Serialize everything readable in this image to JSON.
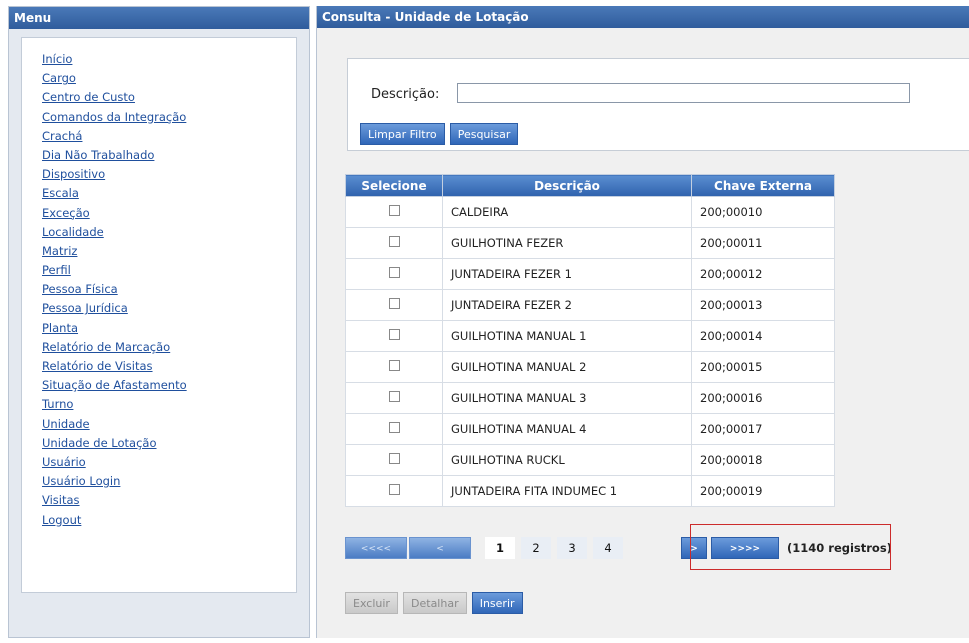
{
  "sidebar": {
    "title": "Menu",
    "items": [
      {
        "label": "Início"
      },
      {
        "label": "Cargo"
      },
      {
        "label": "Centro de Custo"
      },
      {
        "label": "Comandos da Integração"
      },
      {
        "label": "Crachá"
      },
      {
        "label": "Dia Não Trabalhado"
      },
      {
        "label": "Dispositivo"
      },
      {
        "label": "Escala"
      },
      {
        "label": "Exceção"
      },
      {
        "label": "Localidade"
      },
      {
        "label": "Matriz"
      },
      {
        "label": "Perfil"
      },
      {
        "label": "Pessoa Física"
      },
      {
        "label": "Pessoa Jurídica"
      },
      {
        "label": "Planta"
      },
      {
        "label": "Relatório de Marcação"
      },
      {
        "label": "Relatório de Visitas"
      },
      {
        "label": "Situação de Afastamento"
      },
      {
        "label": "Turno"
      },
      {
        "label": "Unidade"
      },
      {
        "label": "Unidade de Lotação"
      },
      {
        "label": "Usuário"
      },
      {
        "label": "Usuário Login"
      },
      {
        "label": "Visitas"
      },
      {
        "label": "Logout"
      }
    ]
  },
  "main": {
    "title": "Consulta - Unidade de Lotação",
    "filter": {
      "description_label": "Descrição:",
      "description_value": "",
      "clear_label": "Limpar Filtro",
      "search_label": "Pesquisar"
    },
    "table": {
      "headers": [
        "Selecione",
        "Descrição",
        "Chave Externa"
      ],
      "rows": [
        {
          "descricao": "CALDEIRA",
          "chave": "200;00010"
        },
        {
          "descricao": "GUILHOTINA FEZER",
          "chave": "200;00011"
        },
        {
          "descricao": "JUNTADEIRA FEZER 1",
          "chave": "200;00012"
        },
        {
          "descricao": "JUNTADEIRA FEZER 2",
          "chave": "200;00013"
        },
        {
          "descricao": "GUILHOTINA MANUAL 1",
          "chave": "200;00014"
        },
        {
          "descricao": "GUILHOTINA MANUAL 2",
          "chave": "200;00015"
        },
        {
          "descricao": "GUILHOTINA MANUAL 3",
          "chave": "200;00016"
        },
        {
          "descricao": "GUILHOTINA MANUAL 4",
          "chave": "200;00017"
        },
        {
          "descricao": "GUILHOTINA RUCKL",
          "chave": "200;00018"
        },
        {
          "descricao": "JUNTADEIRA FITA INDUMEC 1",
          "chave": "200;00019"
        }
      ]
    },
    "pager": {
      "first_label": "<<<<",
      "prev_label": "<",
      "pages": [
        "1",
        "2",
        "3",
        "4"
      ],
      "current_page": "1",
      "next_label": ">",
      "last_label": ">>>>",
      "count_text": "(1140 registros)"
    },
    "actions": {
      "delete_label": "Excluir",
      "details_label": "Detalhar",
      "insert_label": "Inserir"
    }
  },
  "colors": {
    "header_blue": "#2f5c9c",
    "link_blue": "#1f4f9d",
    "highlight_red": "#cc2b2b"
  }
}
